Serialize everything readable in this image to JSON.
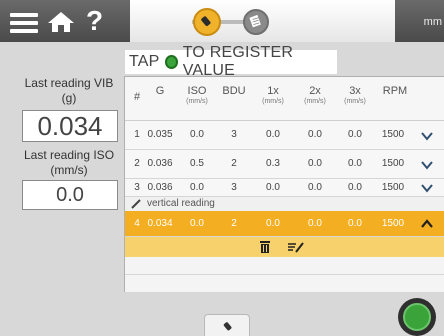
{
  "topbar": {
    "help_label": "?",
    "unit_label": "mm",
    "steps": [
      "sensor-step-icon",
      "list-step-icon"
    ]
  },
  "instruction": {
    "before": "TAP",
    "after": "TO REGISTER VALUE"
  },
  "left_panel": {
    "vib_label_line1": "Last reading VIB",
    "vib_label_line2": "(g)",
    "vib_value": "0.034",
    "iso_label_line1": "Last reading ISO",
    "iso_label_line2": "(mm/s)",
    "iso_value": "0.0"
  },
  "table": {
    "headers": [
      {
        "label": "#",
        "sub": ""
      },
      {
        "label": "G",
        "sub": ""
      },
      {
        "label": "ISO",
        "sub": "(mm/s)"
      },
      {
        "label": "BDU",
        "sub": ""
      },
      {
        "label": "1x",
        "sub": "(mm/s)"
      },
      {
        "label": "2x",
        "sub": "(mm/s)"
      },
      {
        "label": "3x",
        "sub": "(mm/s)"
      },
      {
        "label": "RPM",
        "sub": ""
      }
    ],
    "rows": [
      {
        "cells": [
          "1",
          "0.035",
          "0.0",
          "3",
          "0.0",
          "0.0",
          "0.0",
          "1500"
        ]
      },
      {
        "cells": [
          "2",
          "0.036",
          "0.5",
          "2",
          "0.3",
          "0.0",
          "0.0",
          "1500"
        ]
      },
      {
        "cells": [
          "3",
          "0.036",
          "0.0",
          "3",
          "0.0",
          "0.0",
          "0.0",
          "1500"
        ]
      },
      {
        "cells": [
          "4",
          "0.034",
          "0.0",
          "2",
          "0.0",
          "0.0",
          "0.0",
          "1500"
        ]
      }
    ],
    "note": "vertical reading"
  },
  "colors": {
    "accent": "#f3ae22",
    "confirm": "#3aa33a"
  }
}
